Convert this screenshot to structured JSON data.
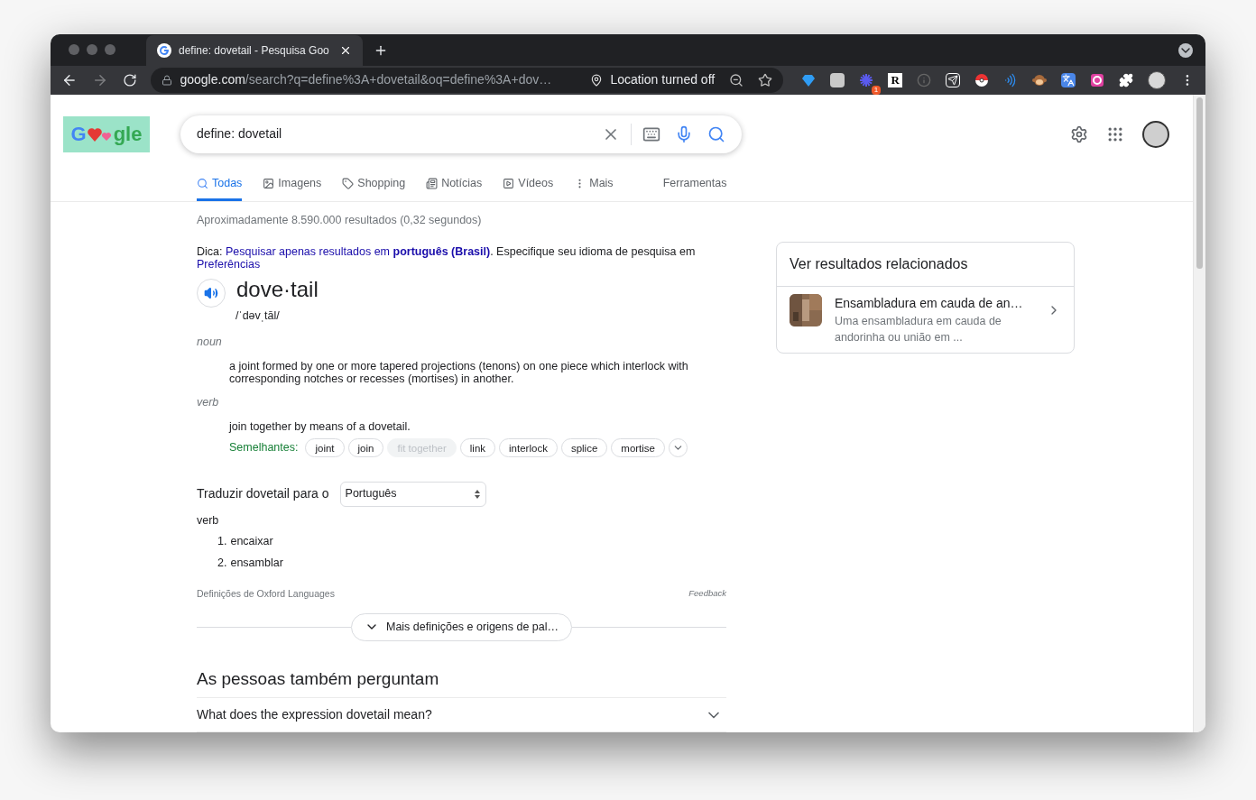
{
  "browser": {
    "tab_title": "define: dovetail - Pesquisa Goo",
    "domain": "google.com",
    "path": "/search?q=define%3A+dovetail&oq=define%3A+dov…",
    "location_chip": "Location turned off"
  },
  "extensions": [
    {
      "kind": "gem"
    },
    {
      "kind": "m-tile"
    },
    {
      "kind": "burst",
      "badge": "1"
    },
    {
      "kind": "letter",
      "text": "R"
    },
    {
      "kind": "info"
    },
    {
      "kind": "send"
    },
    {
      "kind": "ball"
    },
    {
      "kind": "waves"
    },
    {
      "kind": "monkey"
    },
    {
      "kind": "translate"
    },
    {
      "kind": "ring"
    },
    {
      "kind": "puzzle"
    },
    {
      "kind": "avatar"
    }
  ],
  "logo": {
    "parts": [
      "G",
      "gle"
    ]
  },
  "search": {
    "query": "define: dovetail"
  },
  "nav_tabs": [
    {
      "kind": "all",
      "label": "Todas",
      "selected": true
    },
    {
      "kind": "images",
      "label": "Imagens",
      "selected": false
    },
    {
      "kind": "shopping",
      "label": "Shopping",
      "selected": false
    },
    {
      "kind": "news",
      "label": "Notícias",
      "selected": false
    },
    {
      "kind": "videos",
      "label": "Vídeos",
      "selected": false
    },
    {
      "kind": "more",
      "label": "Mais",
      "selected": false
    }
  ],
  "tools": "Ferramentas",
  "result_stats": "Aproximadamente 8.590.000 resultados (0,32 segundos)",
  "tip": {
    "prefix": "Dica:",
    "link": "Pesquisar apenas resultados em **português (Brasil)**",
    "suffix": ". Especifique seu idioma de pesquisa em",
    "link2": "Preferências"
  },
  "dictionary": {
    "word": "dove·tail",
    "phonetic": "/ˈdəvˌtāl/",
    "senses": [
      {
        "pos": "noun",
        "definition": "a joint formed by one or more tapered projections (tenons) on one piece which interlock with corresponding notches or recesses (mortises) in another."
      },
      {
        "pos": "verb",
        "definition": "join together by means of a dovetail.",
        "similar_label": "Semelhantes:",
        "similar": [
          {
            "label": "joint",
            "disabled": false
          },
          {
            "label": "join",
            "disabled": false
          },
          {
            "label": "fit together",
            "disabled": true
          },
          {
            "label": "link",
            "disabled": false
          },
          {
            "label": "interlock",
            "disabled": false
          },
          {
            "label": "splice",
            "disabled": false
          },
          {
            "label": "mortise",
            "disabled": false
          }
        ]
      }
    ]
  },
  "translate": {
    "label": "Traduzir dovetail para o",
    "language": "Português",
    "pos": "verb",
    "items": [
      {
        "number": "1.",
        "text": "encaixar"
      },
      {
        "number": "2.",
        "text": "ensamblar"
      }
    ]
  },
  "source": "Definições de Oxford Languages",
  "feedback": "Feedback",
  "more_button": "Mais definições e origens de pal…",
  "people_also_ask": {
    "title": "As pessoas também perguntam",
    "questions": [
      "What does the expression dovetail mean?"
    ]
  },
  "related": {
    "title": "Ver resultados relacionados",
    "items": [
      {
        "title": "Ensambladura em cauda de an…",
        "snippet": "Uma ensambladura em cauda de andorinha ou união em ..."
      }
    ]
  }
}
